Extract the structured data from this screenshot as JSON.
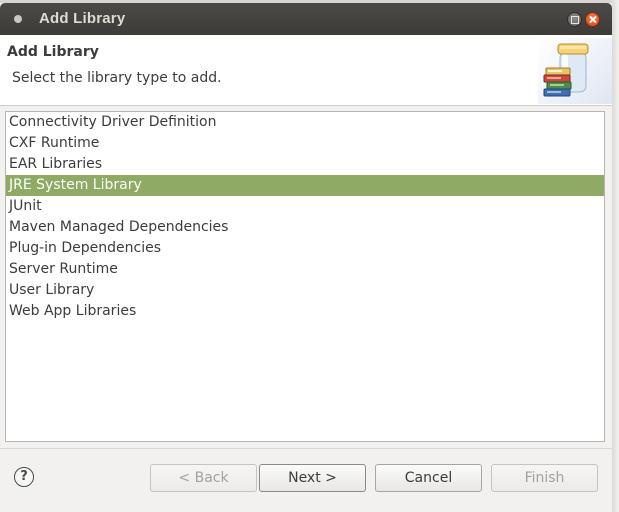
{
  "window": {
    "title": "Add Library"
  },
  "header": {
    "title": "Add Library",
    "description": "Select the library type to add.",
    "banner_icon": "library-jar-books-icon"
  },
  "library_types": [
    {
      "label": "Connectivity Driver Definition",
      "selected": false
    },
    {
      "label": "CXF Runtime",
      "selected": false
    },
    {
      "label": "EAR Libraries",
      "selected": false
    },
    {
      "label": "JRE System Library",
      "selected": true
    },
    {
      "label": "JUnit",
      "selected": false
    },
    {
      "label": "Maven Managed Dependencies",
      "selected": false
    },
    {
      "label": "Plug-in Dependencies",
      "selected": false
    },
    {
      "label": "Server Runtime",
      "selected": false
    },
    {
      "label": "User Library",
      "selected": false
    },
    {
      "label": "Web App Libraries",
      "selected": false
    }
  ],
  "buttons": {
    "help": "?",
    "back": "< Back",
    "next": "Next >",
    "cancel": "Cancel",
    "finish": "Finish"
  },
  "colors": {
    "titlebar": "#3c3b37",
    "selection": "#8eaa64",
    "close_button": "#e05a24"
  }
}
